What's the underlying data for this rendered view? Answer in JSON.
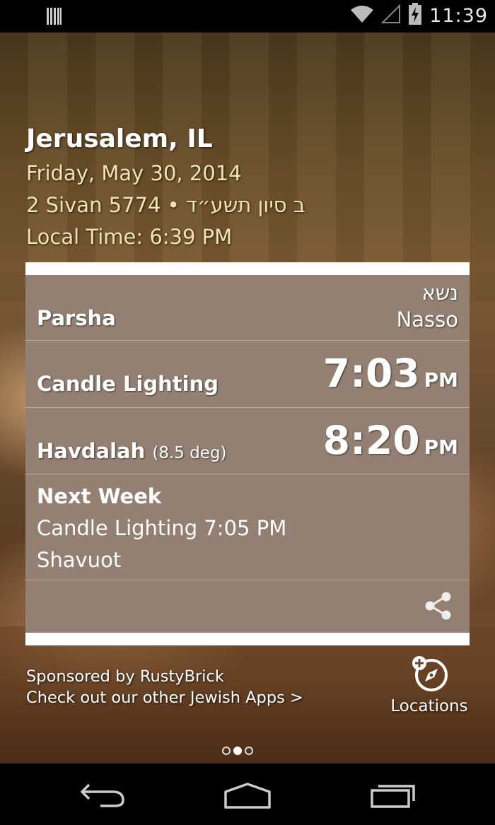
{
  "status_bar": {
    "time": "11:39",
    "icons": [
      "barcode-notification-icon",
      "wifi-icon",
      "signal-icon",
      "battery-charging-icon"
    ]
  },
  "header": {
    "city": "Jerusalem, IL",
    "date": "Friday, May 30, 2014",
    "hebrew_date": "2 Sivan 5774 • ב סיון תשע״ד",
    "local_time": "Local Time: 6:39 PM"
  },
  "card": {
    "parsha": {
      "label": "Parsha",
      "hebrew_name": "נשא",
      "name": "Nasso"
    },
    "candle_lighting": {
      "label": "Candle Lighting",
      "time": "7:03",
      "ampm": "PM"
    },
    "havdalah": {
      "label": "Havdalah",
      "note": "(8.5 deg)",
      "time": "8:20",
      "ampm": "PM"
    },
    "next_week": {
      "title": "Next Week",
      "candle_lighting": "Candle Lighting 7:05 PM",
      "holiday": "Shavuot"
    },
    "share_icon": "share-icon"
  },
  "footer": {
    "sponsor_line1": "Sponsored by RustyBrick",
    "sponsor_line2": "Check out our other Jewish Apps >",
    "locations_label": "Locations",
    "locations_icon": "compass-add-icon"
  },
  "pager": {
    "total": 3,
    "active": 2
  },
  "nav_bar": {
    "icons": [
      "back-icon",
      "home-icon",
      "recent-apps-icon"
    ]
  },
  "colors": {
    "header_accent": "#f1e2b4",
    "card_overlay": "#50321c",
    "card_frame": "#ffffff"
  }
}
